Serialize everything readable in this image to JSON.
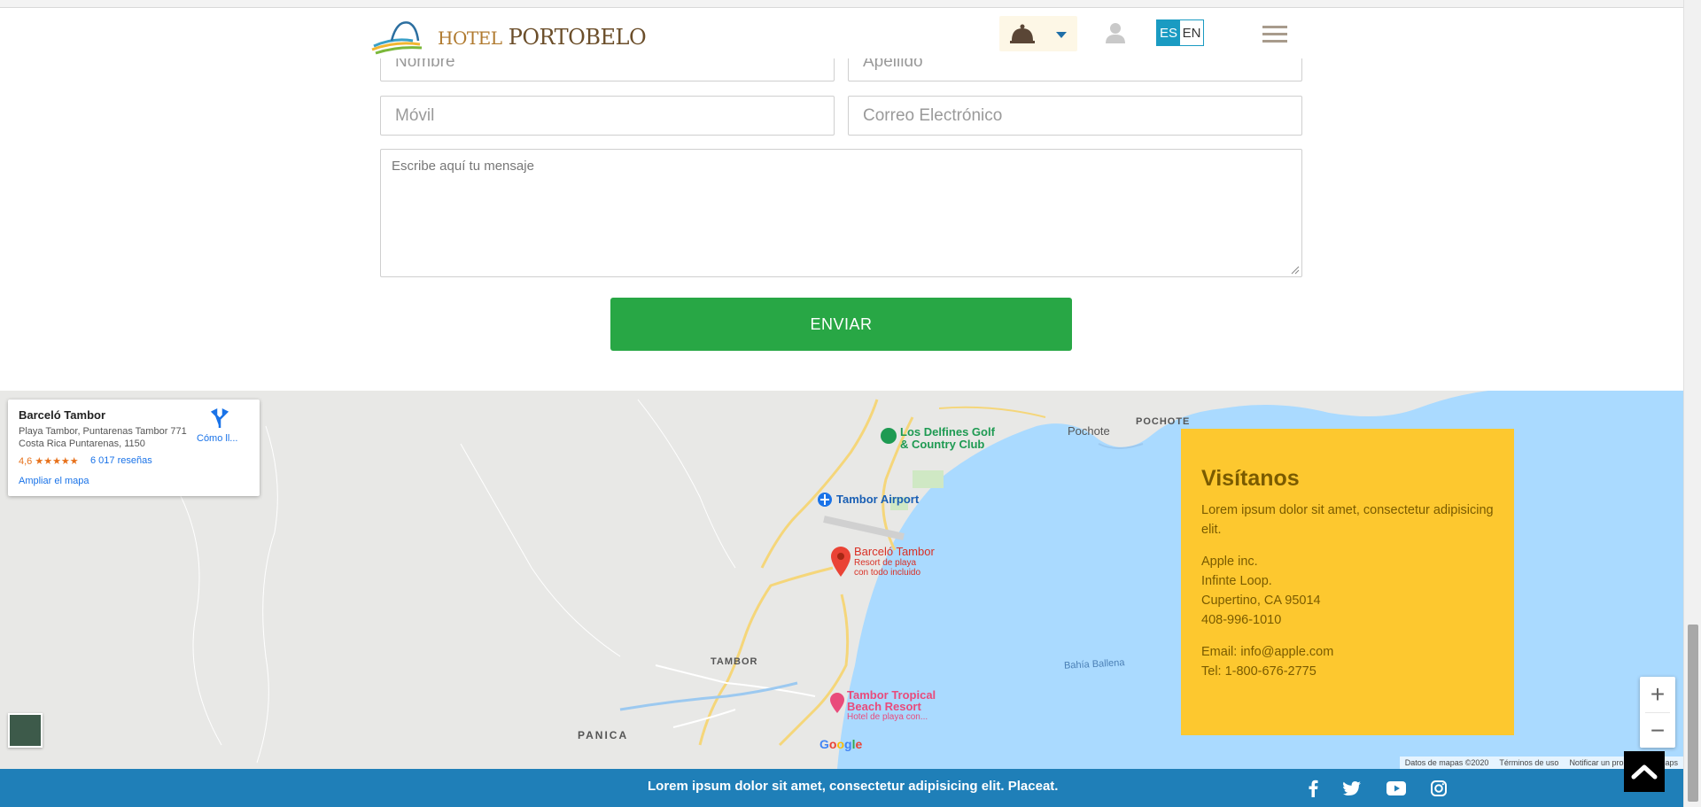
{
  "header": {
    "logo_hotel": "HOTEL",
    "logo_name": "PORTOBELO",
    "lang_es": "ES",
    "lang_en": "EN"
  },
  "form": {
    "nombre_placeholder": "Nombre",
    "apellido_placeholder": "Apellido",
    "movil_placeholder": "Móvil",
    "email_placeholder": "Correo Electrónico",
    "message_placeholder": "Escribe aquí tu mensaje",
    "send_label": "ENVIAR"
  },
  "map": {
    "place_name": "Barceló Tambor",
    "place_address": "Playa Tambor, Puntarenas Tambor 771 Costa Rica Puntarenas, 1150",
    "rating": "4,6 ★★★★★",
    "reviews": "6 017 reseñas",
    "directions_label": "Cómo ll...",
    "enlarge_label": "Ampliar el mapa",
    "labels": {
      "golf": "Los Delfines Golf",
      "golf2": "& Country Club",
      "pochote": "Pochote",
      "pochote_caps": "POCHOTE",
      "airport": "Tambor Airport",
      "hotel": "Barceló Tambor",
      "hotel_sub1": "Resort de playa",
      "hotel_sub2": "con todo incluido",
      "tambor": "TAMBOR",
      "panica": "PANICA",
      "bay": "Bahía Ballena",
      "tropical1": "Tambor Tropical",
      "tropical2": "Beach Resort",
      "tropical_sub": "Hotel de playa con..."
    },
    "google": "Google",
    "footer_data": "Datos de mapas ©2020",
    "footer_terms": "Términos de uso",
    "footer_report": "Notificar un problema de Maps",
    "zoom_in": "+",
    "zoom_out": "−"
  },
  "visit": {
    "title": "Visítanos",
    "intro": "Lorem ipsum dolor sit amet, consectetur adipisicing elit.",
    "company": "Apple inc.",
    "street": "Infinte Loop.",
    "city": "Cupertino, CA 95014",
    "phone": "408-996-1010",
    "email": "Email: info@apple.com",
    "tel": "Tel: 1-800-676-2775"
  },
  "footer": {
    "text": "Lorem ipsum dolor sit amet, consectetur adipisicing elit. Placeat."
  },
  "colors": {
    "accent_green": "#28a745",
    "footer_blue": "#1f7fb8",
    "visit_yellow": "#fdc82f",
    "lang_blue": "#1a9bc2"
  }
}
